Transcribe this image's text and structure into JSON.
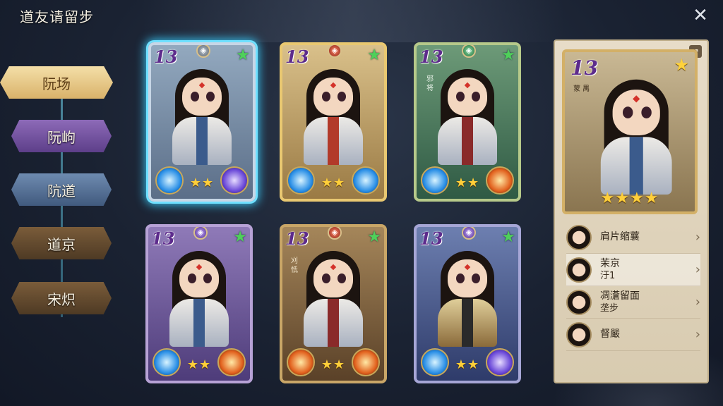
{
  "header": {
    "title": "道友请留步",
    "close_label": "✕"
  },
  "nav": {
    "items": [
      {
        "label": "阮场",
        "active": true
      },
      {
        "label": "阮岣"
      },
      {
        "label": "阬道"
      },
      {
        "label": "道京"
      },
      {
        "label": "宋炽"
      }
    ]
  },
  "cards": [
    {
      "grade": "13",
      "stars": "★★",
      "selected": true
    },
    {
      "grade": "13",
      "stars": "★★"
    },
    {
      "grade": "13",
      "stars": "★★",
      "tag": "邪将"
    },
    {
      "grade": "13",
      "stars": "★★"
    },
    {
      "grade": "13",
      "stars": "★★",
      "tag": "刈忯"
    },
    {
      "grade": "13",
      "stars": "★★"
    }
  ],
  "detail": {
    "grade": "13",
    "side_tag": "蒙 禺",
    "stars": "★★★★",
    "star_top": "★",
    "list": [
      {
        "title": "肩片缩蘘",
        "sub": ""
      },
      {
        "title": "茉京",
        "sub": "汙1"
      },
      {
        "title": "凋濸留面",
        "sub": "垄步"
      },
      {
        "title": "督嚴",
        "sub": ""
      }
    ]
  },
  "icons": {
    "close": "close-icon",
    "chevron": "chevron-right-icon",
    "star": "star-icon"
  },
  "colors": {
    "active_nav": "#d9b26a",
    "selected_glow": "#38c7f5",
    "star_yellow": "#ffcf3a",
    "star_green": "#4fd05a"
  }
}
